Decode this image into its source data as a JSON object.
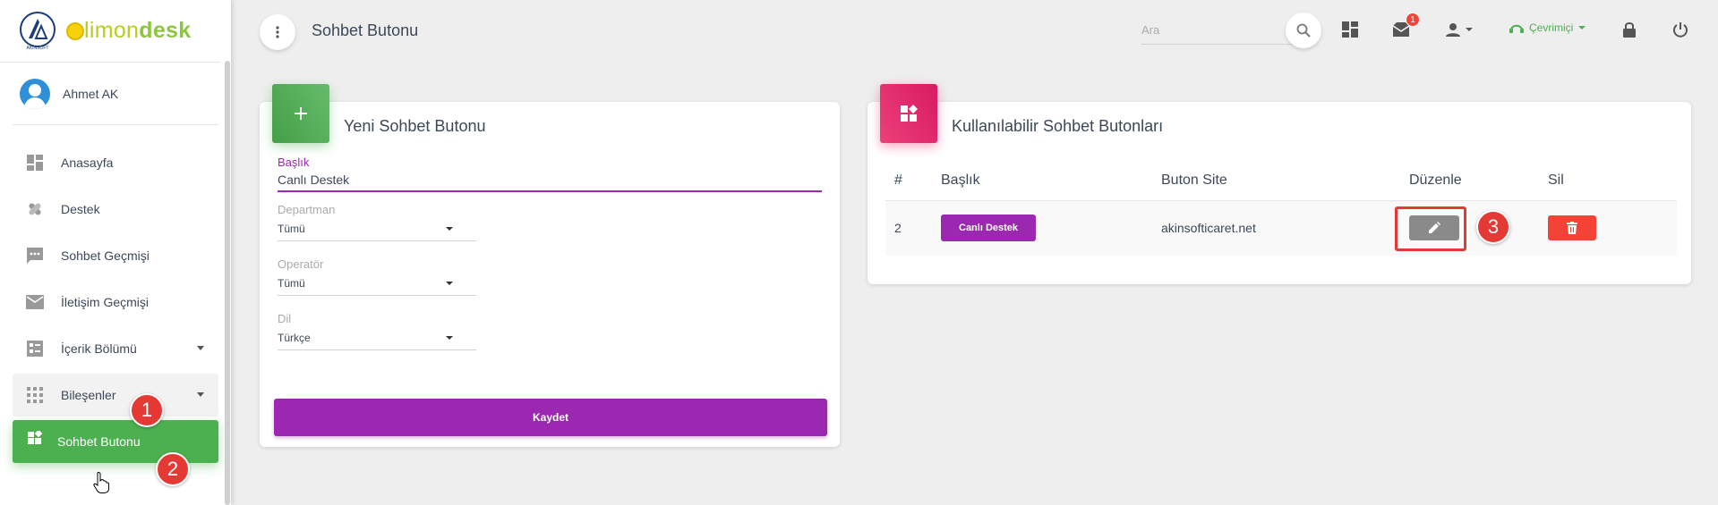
{
  "colors": {
    "primary": "#9c27b0",
    "success": "#4caf50",
    "pink": "#e91e63",
    "danger": "#f44336",
    "edit_gray": "#8a8a8a",
    "annotation_red": "#e53935"
  },
  "brand": {
    "company_mark": "AKINSOFT",
    "logo_prefix": "limon",
    "logo_suffix": "desk"
  },
  "user": {
    "name": "Ahmet AK"
  },
  "sidebar": {
    "items": [
      {
        "label": "Anasayfa",
        "icon": "dashboard-icon"
      },
      {
        "label": "Destek",
        "icon": "support-icon"
      },
      {
        "label": "Sohbet Geçmişi",
        "icon": "chat-icon"
      },
      {
        "label": "İletişim Geçmişi",
        "icon": "mail-icon"
      },
      {
        "label": "İçerik Bölümü",
        "icon": "content-icon"
      },
      {
        "label": "Bileşenler",
        "icon": "apps-icon"
      },
      {
        "label": "Sohbet Butonu",
        "icon": "widgets-icon"
      }
    ]
  },
  "annotations": {
    "step1": "1",
    "step2": "2",
    "step3": "3"
  },
  "header": {
    "title": "Sohbet Butonu",
    "search_placeholder": "Ara",
    "notification_count": "1",
    "status": "Çevrimiçi"
  },
  "new_card": {
    "title": "Yeni Sohbet Butonu",
    "title_field": {
      "label": "Başlık",
      "value": "Canlı Destek"
    },
    "department": {
      "label": "Departman",
      "value": "Tümü"
    },
    "operator": {
      "label": "Operatör",
      "value": "Tümü"
    },
    "language": {
      "label": "Dil",
      "value": "Türkçe"
    },
    "save_label": "Kaydet"
  },
  "list_card": {
    "title": "Kullanılabilir Sohbet Butonları",
    "columns": [
      "#",
      "Başlık",
      "Buton Site",
      "Düzenle",
      "Sil"
    ],
    "rows": [
      {
        "id": "2",
        "title": "Canlı Destek",
        "site": "akinsofticaret.net"
      }
    ]
  }
}
